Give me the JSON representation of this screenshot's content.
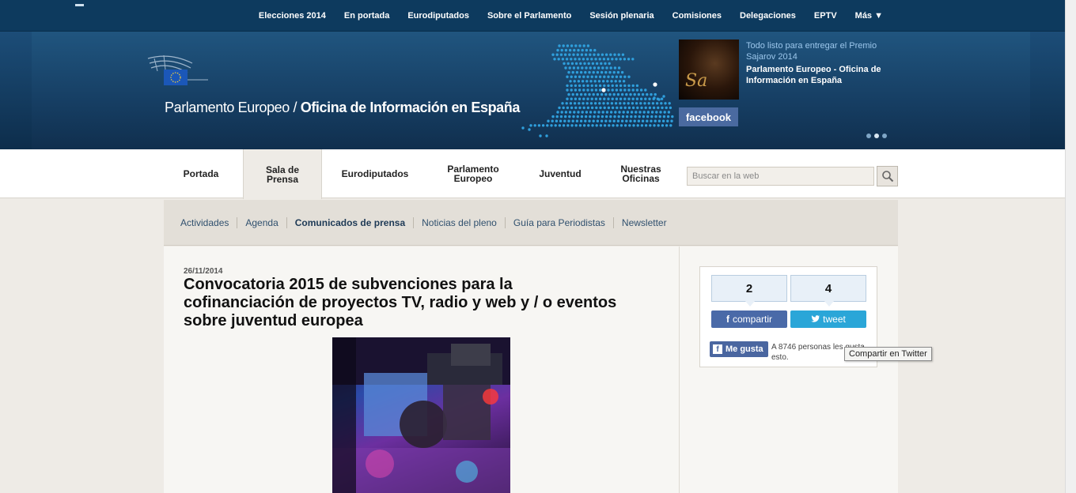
{
  "topnav": {
    "items": [
      "Elecciones 2014",
      "En portada",
      "Eurodiputados",
      "Sobre el Parlamento",
      "Sesión plenaria",
      "Comisiones",
      "Delegaciones",
      "EPTV",
      "Más ▼"
    ]
  },
  "banner": {
    "title_light": "Parlamento Europeo / ",
    "title_bold": "Oficina de Información en España",
    "thumb_text": "Sa",
    "facebook_label": "facebook",
    "news_link": "Todo listo para entregar el Premio Sajarov 2014",
    "news_sub": "Parlamento Europeo - Oficina de Información en España"
  },
  "mainnav": {
    "items": [
      {
        "label": "Portada"
      },
      {
        "label": "Sala de Prensa"
      },
      {
        "label": "Eurodiputados"
      },
      {
        "label": "Parlamento Europeo"
      },
      {
        "label": "Juventud"
      },
      {
        "label": "Nuestras Oficinas"
      }
    ],
    "search_placeholder": "Buscar en la web"
  },
  "subnav": {
    "items": [
      "Actividades",
      "Agenda",
      "Comunicados de prensa",
      "Noticias del pleno",
      "Guía para Periodistas",
      "Newsletter"
    ]
  },
  "article": {
    "date": "26/11/2014",
    "headline": "Convocatoria 2015 de subvenciones para la cofinanciación de proyectos TV, radio y web y / o eventos sobre juventud europea"
  },
  "share": {
    "fb_count": "2",
    "tw_count": "4",
    "fb_label": "compartir",
    "tw_label": "tweet",
    "like_label": "Me gusta",
    "like_text": "A 8746 personas les gusta esto.",
    "tooltip": "Compartir en Twitter"
  },
  "colors": {
    "topbar": "#0d3a5e",
    "facebook": "#4a6aa8",
    "twitter": "#2aa6d8"
  }
}
